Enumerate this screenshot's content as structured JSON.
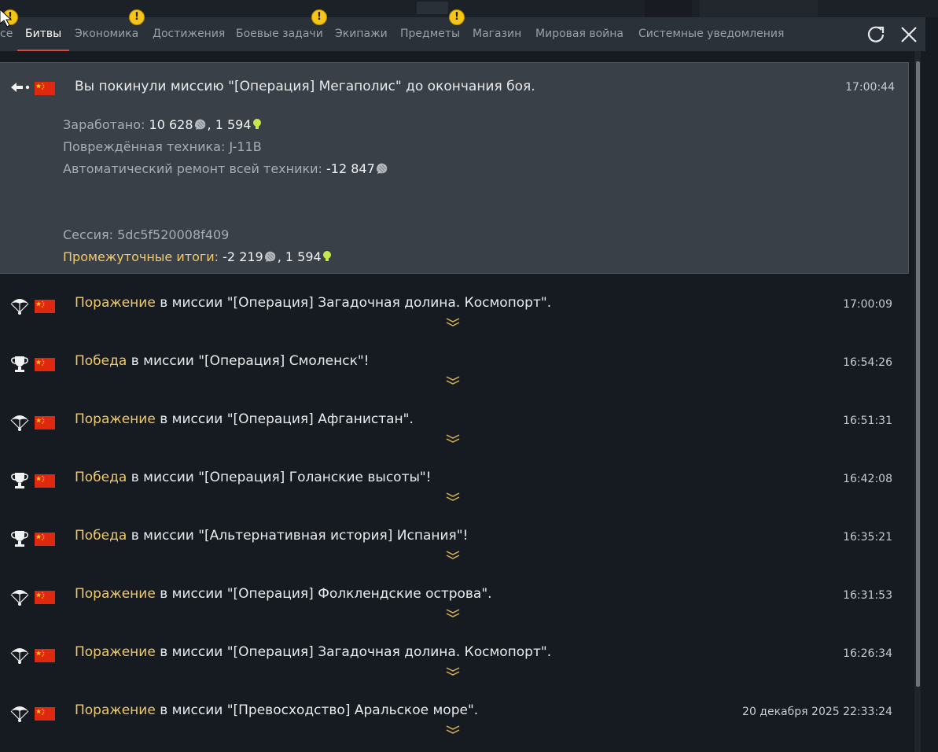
{
  "tabs": [
    {
      "label": "се",
      "active": false,
      "warning": true
    },
    {
      "label": "Битвы",
      "active": true,
      "warning": false
    },
    {
      "label": "Экономика",
      "active": false,
      "warning": true
    },
    {
      "label": "Достижения",
      "active": false,
      "warning": false
    },
    {
      "label": "Боевые задачи",
      "active": false,
      "warning": true
    },
    {
      "label": "Экипажи",
      "active": false,
      "warning": false
    },
    {
      "label": "Предметы",
      "active": false,
      "warning": true
    },
    {
      "label": "Магазин",
      "active": false,
      "warning": false
    },
    {
      "label": "Мировая война",
      "active": false,
      "warning": false
    },
    {
      "label": "Системные уведомления",
      "active": false,
      "warning": false
    }
  ],
  "warning_glyph": "!",
  "toolbar": {
    "refresh_icon": "refresh-icon",
    "close_icon": "close-icon"
  },
  "expanded_entry": {
    "icon": "leave-arrow-icon",
    "flag": "china-flag",
    "title": "Вы покинули миссию \"[Операция] Мегаполис\" до окончания боя.",
    "time": "17:00:44",
    "earned_label": "Заработано: ",
    "earned_silver": "10 628",
    "earned_sep": ", ",
    "earned_rp": "1 594",
    "damaged_label": "Повреждённая техника: ",
    "damaged_value": "J-11B",
    "repair_label": "Автоматический ремонт всей техники: ",
    "repair_value": "-12 847",
    "session_label": "Сессия: ",
    "session_value": "5dc5f520008f409",
    "subtotal_label": "Промежуточные итоги: ",
    "subtotal_silver": "-2 219",
    "subtotal_sep": ", ",
    "subtotal_rp": "1 594"
  },
  "entries": [
    {
      "icon": "parachute-icon",
      "result": "Поражение",
      "text": " в миссии \"[Операция] Загадочная долина. Космопорт\".",
      "time": "17:00:09"
    },
    {
      "icon": "trophy-icon",
      "result": "Победа",
      "text": " в миссии \"[Операция] Смоленск\"!",
      "time": "16:54:26"
    },
    {
      "icon": "parachute-icon",
      "result": "Поражение",
      "text": " в миссии \"[Операция] Афганистан\".",
      "time": "16:51:31"
    },
    {
      "icon": "trophy-icon",
      "result": "Победа",
      "text": " в миссии \"[Операция] Голанские высоты\"!",
      "time": "16:42:08"
    },
    {
      "icon": "trophy-icon",
      "result": "Победа",
      "text": " в миссии \"[Альтернативная история] Испания\"!",
      "time": "16:35:21"
    },
    {
      "icon": "parachute-icon",
      "result": "Поражение",
      "text": " в миссии \"[Операция] Фолклендские острова\".",
      "time": "16:31:53"
    },
    {
      "icon": "parachute-icon",
      "result": "Поражение",
      "text": " в миссии \"[Операция] Загадочная долина. Космопорт\".",
      "time": "16:26:34"
    },
    {
      "icon": "parachute-icon",
      "result": "Поражение",
      "text": " в миссии \"[Превосходство] Аральское море\".",
      "time": "20 декабря 2025 22:33:24"
    }
  ],
  "colors": {
    "accent_result": "#f0c96a",
    "active_tab_underline": "#d64a3b",
    "rp_icon": "#c8e64a"
  }
}
